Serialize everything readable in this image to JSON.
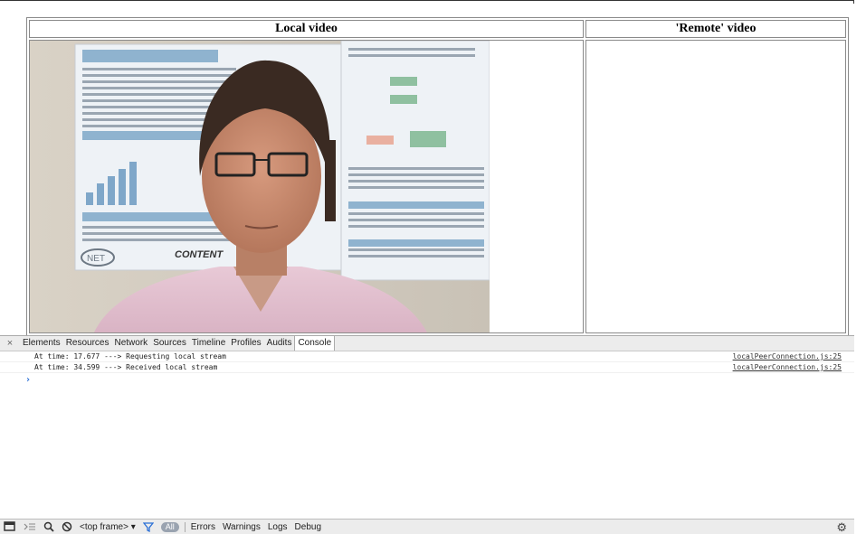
{
  "headers": {
    "local": "Local video",
    "remote": "'Remote' video"
  },
  "devtools": {
    "close": "×",
    "tabs": [
      "Elements",
      "Resources",
      "Network",
      "Sources",
      "Timeline",
      "Profiles",
      "Audits",
      "Console"
    ],
    "active_tab": "Console"
  },
  "console": {
    "logs": [
      {
        "message": "At time: 17.677 ---> Requesting local stream",
        "source": "localPeerConnection.js:25"
      },
      {
        "message": "At time: 34.599 ---> Received local stream",
        "source": "localPeerConnection.js:25"
      }
    ],
    "prompt": "›"
  },
  "bottom_bar": {
    "frame": "<top frame> ▾",
    "all": "All",
    "levels": [
      "Errors",
      "Warnings",
      "Logs",
      "Debug"
    ]
  },
  "icons": [
    "dock-icon",
    "drawer-icon",
    "search-icon",
    "clear-icon",
    "filter-icon",
    "gear-icon"
  ]
}
